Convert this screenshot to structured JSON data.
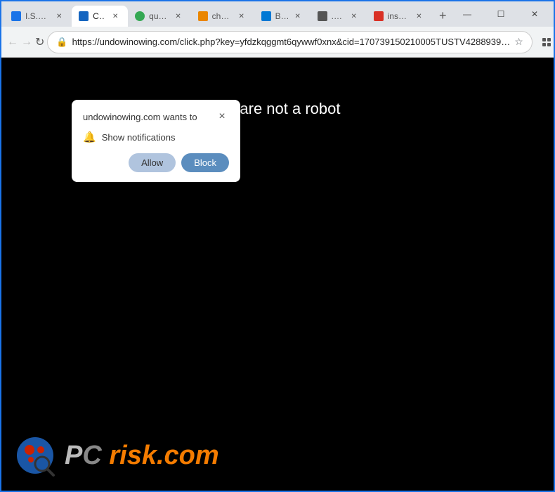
{
  "browser": {
    "tabs": [
      {
        "id": "tab1",
        "label": "I.S.S. (…",
        "active": false,
        "favicon_color": "#1a73e8"
      },
      {
        "id": "tab2",
        "label": "Click",
        "active": true,
        "favicon_color": "#1565c0"
      },
      {
        "id": "tab3",
        "label": "quinc…",
        "active": false,
        "favicon_color": "#34a853"
      },
      {
        "id": "tab4",
        "label": "chatu…",
        "active": false,
        "favicon_color": "#ea8600"
      },
      {
        "id": "tab5",
        "label": "Bing",
        "active": false,
        "favicon_color": "#0078d4"
      },
      {
        "id": "tab6",
        "label": ".com",
        "active": false,
        "favicon_color": "#555"
      },
      {
        "id": "tab7",
        "label": "insure…",
        "active": false,
        "favicon_color": "#d93025"
      }
    ],
    "new_tab_label": "+",
    "window_controls": {
      "minimize": "—",
      "maximize": "☐",
      "close": "✕"
    },
    "address_bar": {
      "url": "https://undowinowing.com/click.php?key=yfdzkqggmt6qywwf0xnx&cid=170739150210005TUSTV4288939…",
      "lock_icon": "🔒"
    },
    "nav": {
      "back": "←",
      "forward": "→",
      "reload": "↻"
    }
  },
  "page": {
    "background_color": "#000000",
    "main_text": "nfirm that you are not a robot",
    "text_color": "#ffffff"
  },
  "notification_popup": {
    "title": "undowinowing.com wants to",
    "close_label": "×",
    "notification_row": {
      "bell_icon": "🔔",
      "text": "Show notifications"
    },
    "buttons": {
      "allow": "Allow",
      "block": "Block"
    }
  },
  "watermark": {
    "text_pc": "PC",
    "text_risk": "risk",
    "text_dotcom": ".com"
  }
}
